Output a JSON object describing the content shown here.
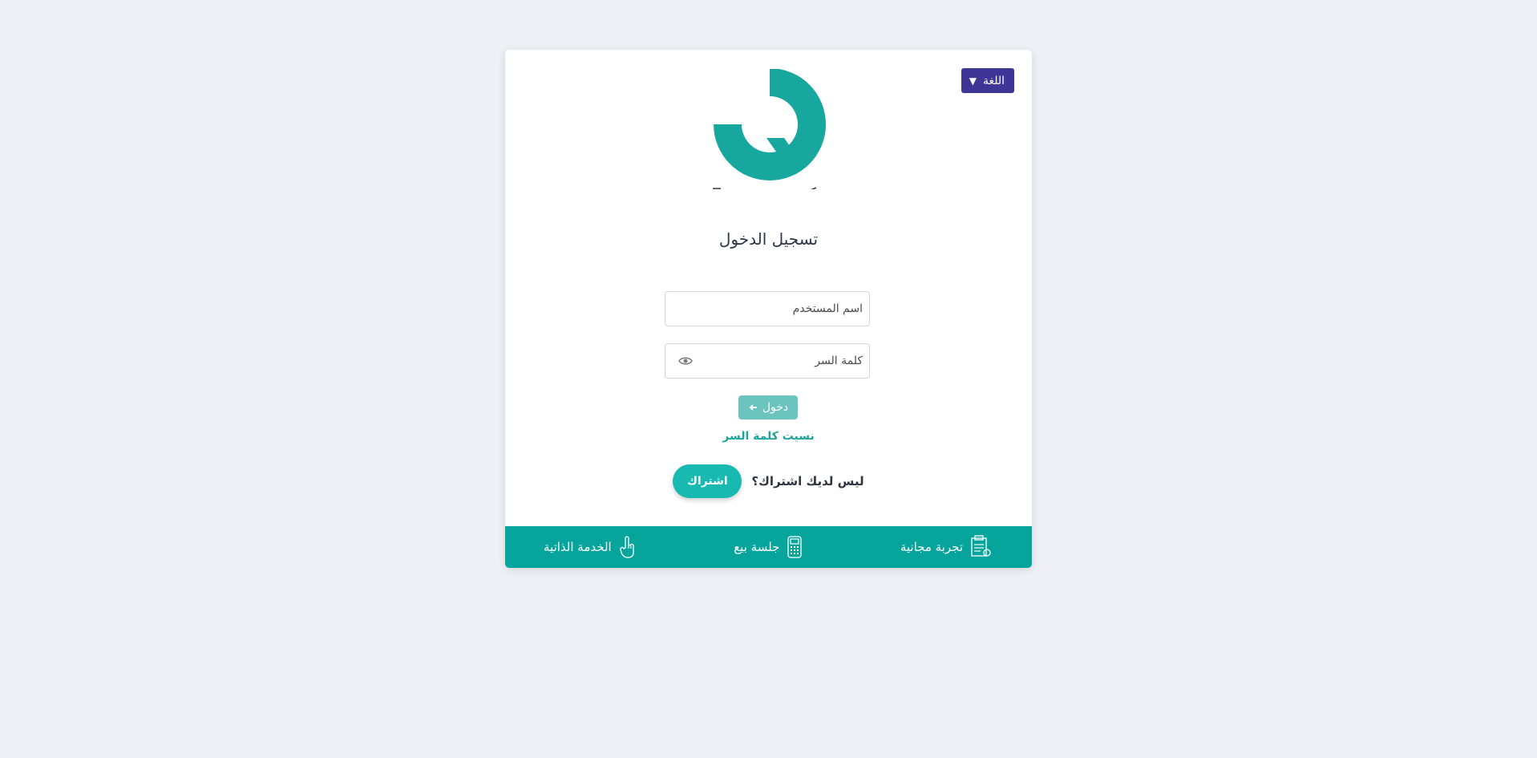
{
  "language_button": {
    "label": "اللغة",
    "caret": "▼"
  },
  "logo": {
    "wordmark": "كوانتم",
    "icon": "quantum-q-logo"
  },
  "title": "تسجيل الدخول",
  "form": {
    "username_placeholder": "اسم المستخدم",
    "username_value": "",
    "password_placeholder": "كلمة السر",
    "password_value": "",
    "login_label": "دخول",
    "forgot_label": "نسيت كلمة السر"
  },
  "subscribe": {
    "question": "ليس لديك اشتراك؟",
    "button_label": "اشتراك"
  },
  "footer": {
    "items": [
      {
        "label": "تجربة مجانية",
        "icon": "free-trial-icon"
      },
      {
        "label": "جلسة بيع",
        "icon": "pos-terminal-icon"
      },
      {
        "label": "الخدمة الذاتية",
        "icon": "hand-pointer-icon"
      }
    ]
  },
  "colors": {
    "brand_teal": "#06a49b",
    "logo_teal": "#17a79e",
    "language_purple": "#3f3597",
    "login_button": "#6cc4bf",
    "subscribe_button": "#18b9b1",
    "page_background": "#eef0f5"
  }
}
